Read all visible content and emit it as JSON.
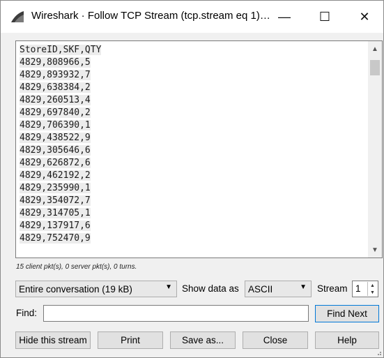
{
  "window": {
    "title": "Wireshark · Follow TCP Stream (tcp.stream eq 1)…",
    "minimize_glyph": "—",
    "maximize_glyph": "☐",
    "close_glyph": "✕"
  },
  "stream": {
    "lines": [
      "StoreID,SKF,QTY",
      "4829,808966,5",
      "4829,893932,7",
      "4829,638384,2",
      "4829,260513,4",
      "4829,697840,2",
      "4829,706390,1",
      "4829,438522,9",
      "4829,305646,6",
      "4829,626872,6",
      "4829,462192,2",
      "4829,235990,1",
      "4829,354072,7",
      "4829,314705,1",
      "4829,137917,6",
      "4829,752470,9"
    ]
  },
  "status": "15 client pkt(s), 0 server pkt(s), 0 turns.",
  "controls": {
    "conversation_value": "Entire conversation (19 kB)",
    "show_data_label": "Show data as",
    "show_data_value": "ASCII",
    "stream_label": "Stream",
    "stream_value": "1",
    "find_label": "Find:",
    "find_value": "",
    "find_next_label": "Find Next"
  },
  "buttons": {
    "hide": "Hide this stream",
    "print": "Print",
    "save": "Save as...",
    "close": "Close",
    "help": "Help"
  },
  "icons": {
    "app": "wireshark-fin-icon",
    "dropdown": "chevron-down-icon",
    "scroll_up": "scroll-up-arrow-icon",
    "scroll_down": "scroll-down-arrow-icon"
  }
}
